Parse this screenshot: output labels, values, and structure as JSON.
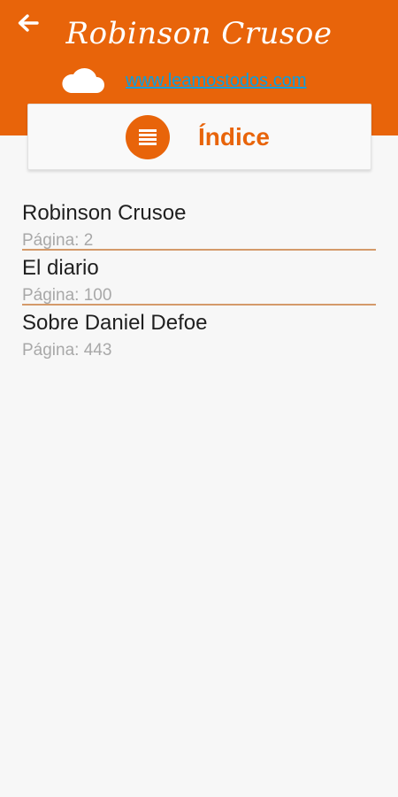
{
  "header": {
    "title": "Robinson Crusoe",
    "website": "www.leamostodos.com",
    "back_icon": "arrow-left-icon",
    "cloud_icon": "cloud-icon",
    "color": "#e8640a"
  },
  "index": {
    "label": "Índice",
    "icon": "list-icon"
  },
  "chapters": [
    {
      "title": "Robinson Crusoe",
      "page": "Página: 2"
    },
    {
      "title": "El diario",
      "page": "Página: 100"
    },
    {
      "title": "Sobre Daniel Defoe",
      "page": "Página: 443"
    }
  ]
}
